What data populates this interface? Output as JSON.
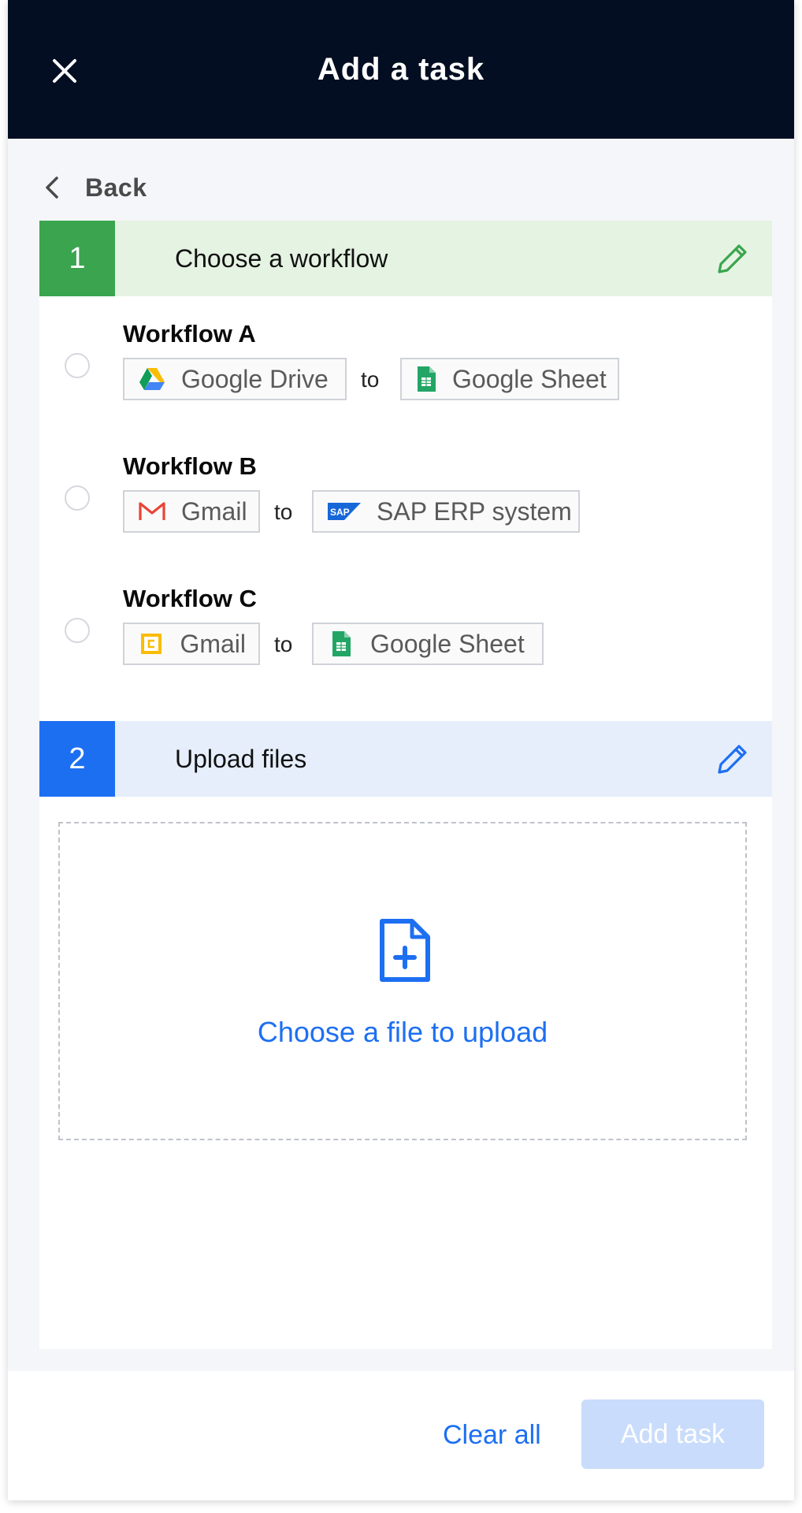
{
  "header": {
    "title": "Add a task",
    "close_icon": "close-icon"
  },
  "back": {
    "label": "Back",
    "icon": "chevron-left-icon"
  },
  "steps": [
    {
      "number": "1",
      "title": "Choose a workflow",
      "accent": "#3aa54e",
      "edit_icon": "pencil-icon"
    },
    {
      "number": "2",
      "title": "Upload files",
      "accent": "#1d6ff2",
      "edit_icon": "pencil-icon"
    }
  ],
  "workflows": [
    {
      "name": "Workflow A",
      "source": {
        "label": "Google Drive",
        "icon": "google-drive-icon"
      },
      "connector": "to",
      "target": {
        "label": "Google Sheet",
        "icon": "google-sheets-icon"
      }
    },
    {
      "name": "Workflow B",
      "source": {
        "label": "Gmail",
        "icon": "gmail-icon"
      },
      "connector": "to",
      "target": {
        "label": "SAP ERP system",
        "icon": "sap-icon"
      }
    },
    {
      "name": "Workflow C",
      "source": {
        "label": "Gmail",
        "icon": "calendar-icon"
      },
      "connector": "to",
      "target": {
        "label": "Google Sheet",
        "icon": "google-sheets-icon"
      }
    }
  ],
  "upload": {
    "label": "Choose a file to upload",
    "icon": "file-add-icon"
  },
  "footer": {
    "clear_label": "Clear all",
    "submit_label": "Add task"
  }
}
